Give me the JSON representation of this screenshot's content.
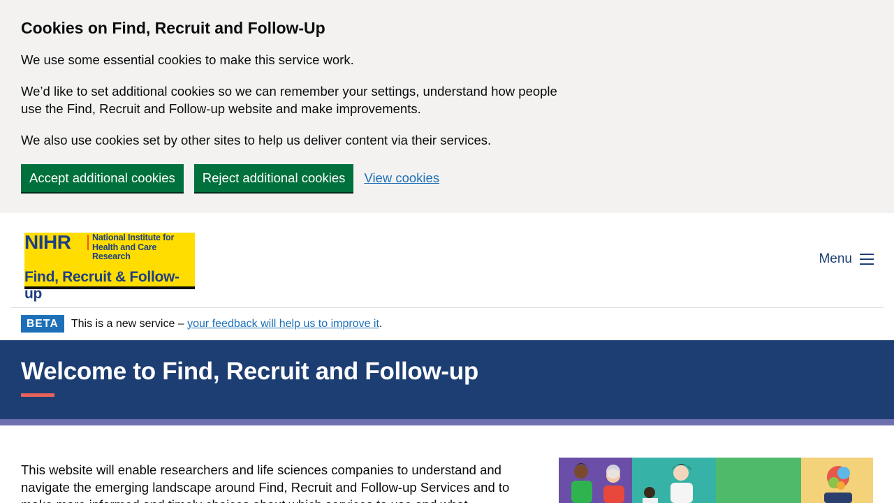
{
  "cookie_banner": {
    "title": "Cookies on Find, Recruit and Follow-Up",
    "p1": "We use some essential cookies to make this service work.",
    "p2": "We’d like to set additional cookies so we can remember your settings, understand how people use the Find, Recruit and Follow-up website and make improvements.",
    "p3": "We also use cookies set by other sites to help us deliver content via their services.",
    "accept_label": "Accept additional cookies",
    "reject_label": "Reject additional cookies",
    "view_label": "View cookies"
  },
  "header": {
    "logo": {
      "acronym": "NIHR",
      "institute_line1": "National Institute for",
      "institute_line2": "Health and Care Research",
      "service_name": "Find, Recruit & Follow-up"
    },
    "menu_label": "Menu",
    "menu_icon": "hamburger-icon"
  },
  "beta_banner": {
    "tag": "BETA",
    "text": "This is a new service – ",
    "link": "your feedback will help us to improve it",
    "suffix": "."
  },
  "hero": {
    "title": "Welcome to Find, Recruit and Follow-up"
  },
  "main": {
    "intro": "This website will enable researchers and life sciences companies to understand and navigate the emerging landscape around Find, Recruit and Follow-up Services and to make more informed and timely choices about which services to use and what"
  },
  "colors": {
    "accent_green": "#00703c",
    "link_blue": "#1d70b8",
    "hero_navy": "#1d3e72",
    "stripe_purple": "#6e6faf",
    "logo_yellow": "#ffdd00",
    "hero_underline": "#e9625a"
  }
}
